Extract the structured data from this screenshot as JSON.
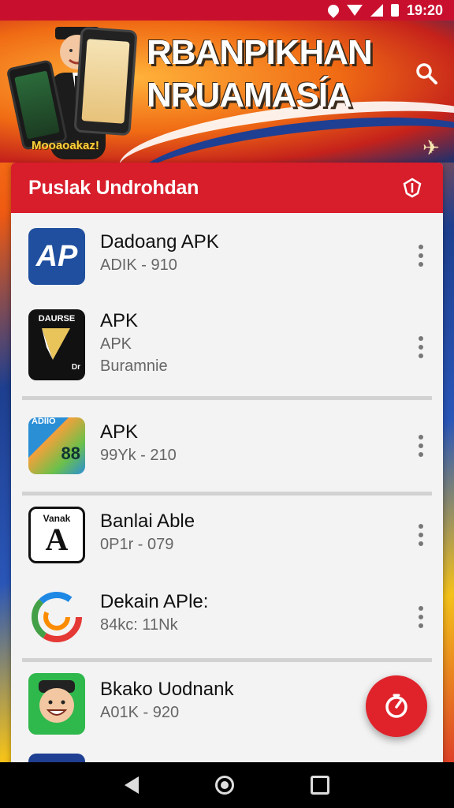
{
  "status_bar": {
    "time": "19:20"
  },
  "banner": {
    "title_line1": "RBANPIKHAN",
    "title_line2": "NRUAMASÍA",
    "caption": "Mooaoakaz!"
  },
  "card": {
    "title": "Puslak Undrohdan"
  },
  "apps": [
    {
      "name": "Dadoang APK",
      "sub1": "ADIK - 910",
      "sub2": "",
      "icon": "apk-blue-icon",
      "icon_text": "AP",
      "color": "#1f4f9e"
    },
    {
      "name": "APK",
      "sub1": "APK",
      "sub2": "Buramnie",
      "icon": "apk-black-arrow-icon",
      "icon_text": "DAURSE",
      "icon_text2": "Dr",
      "color": "#111111"
    },
    {
      "name": "APK",
      "sub1": "99Yk - 210",
      "sub2": "",
      "icon": "apk-orange-map-icon",
      "icon_text": "ADIIO",
      "icon_text2": "88",
      "color": "#2b8fd6"
    },
    {
      "name": "Banlai Able",
      "sub1": "0P1r - 079",
      "sub2": "",
      "icon": "apk-black-a-icon",
      "icon_text": "Vanak",
      "icon_text2": "A",
      "color": "#111111"
    },
    {
      "name": "Dekain APle:",
      "sub1": "84kc: 11Nk",
      "sub2": "",
      "icon": "apk-rainbow-swirl-icon",
      "color": "#ffffff"
    },
    {
      "name": "Bkako Uodnank",
      "sub1": "A01K - 920",
      "sub2": "",
      "icon": "apk-cartoon-face-icon",
      "color": "#2fb84c"
    }
  ]
}
